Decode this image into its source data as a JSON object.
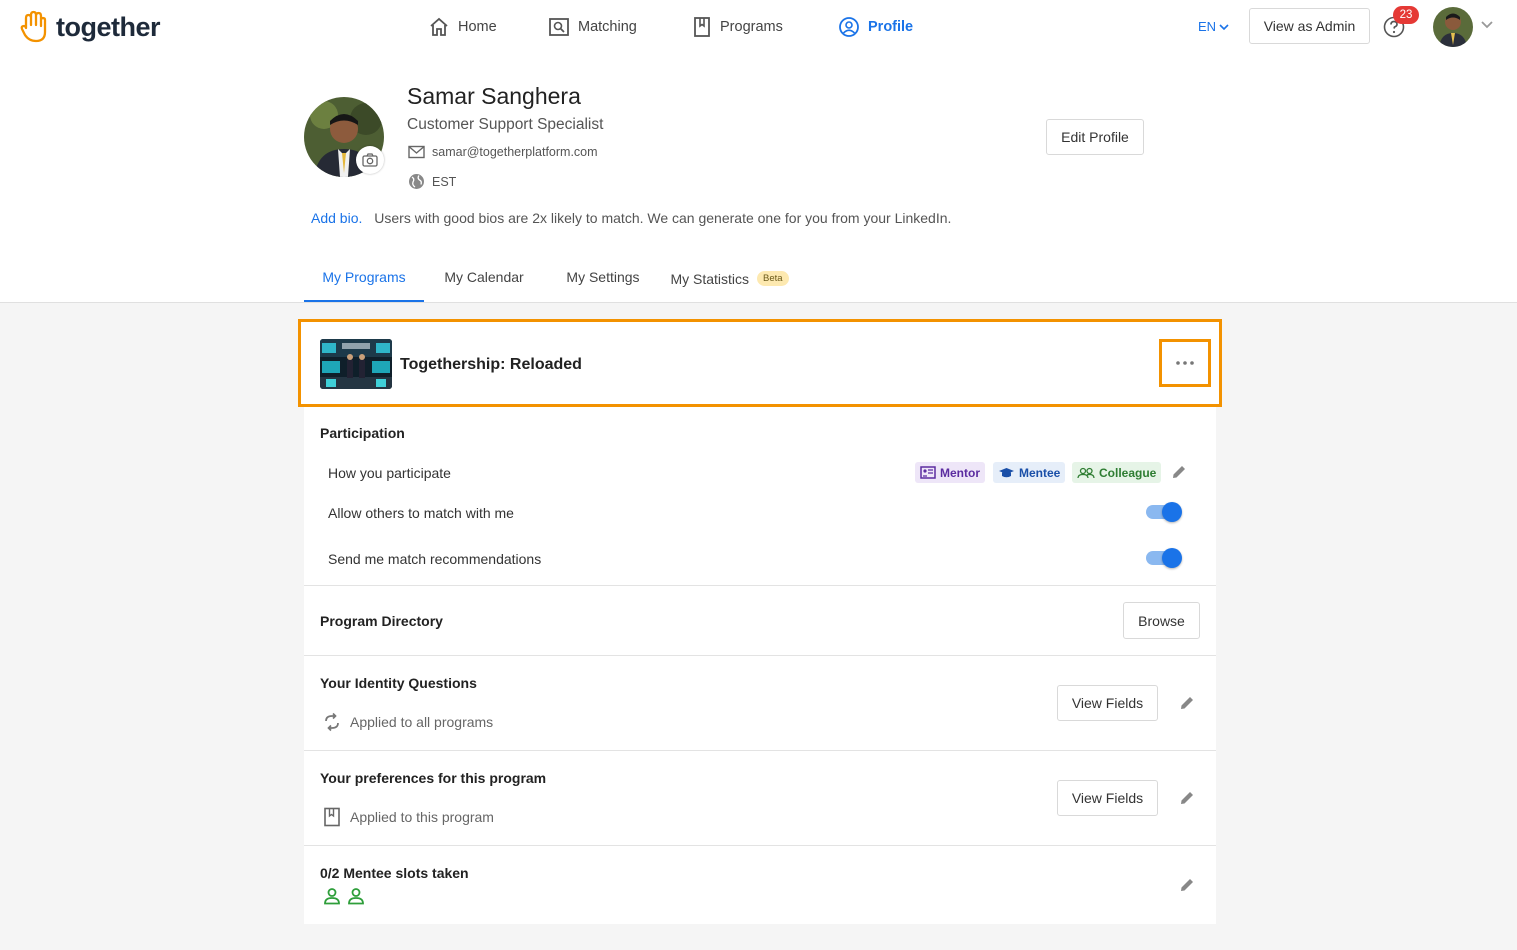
{
  "header": {
    "logo_text": "together",
    "nav": [
      {
        "label": "Home",
        "icon": "home-icon"
      },
      {
        "label": "Matching",
        "icon": "matching-icon"
      },
      {
        "label": "Programs",
        "icon": "programs-icon"
      },
      {
        "label": "Profile",
        "icon": "profile-icon"
      }
    ],
    "language": "EN",
    "admin_button": "View as Admin",
    "notifications_count": "23"
  },
  "profile": {
    "name": "Samar Sanghera",
    "title": "Customer Support Specialist",
    "email": "samar@togetherplatform.com",
    "timezone": "EST",
    "edit_button": "Edit Profile",
    "add_bio_link": "Add bio.",
    "bio_hint": "Users with good bios are 2x likely to match. We can generate one for you from your LinkedIn."
  },
  "tabs": [
    {
      "label": "My Programs",
      "active": true
    },
    {
      "label": "My Calendar",
      "active": false
    },
    {
      "label": "My Settings",
      "active": false
    },
    {
      "label": "My Statistics",
      "active": false,
      "badge": "Beta"
    }
  ],
  "program": {
    "title": "Togethership: Reloaded",
    "participation": {
      "heading": "Participation",
      "how_label": "How you participate",
      "roles": [
        {
          "label": "Mentor",
          "color": "#5b2ca0",
          "bg": "#eee6f8"
        },
        {
          "label": "Mentee",
          "color": "#1a4fa8",
          "bg": "#e6eef9"
        },
        {
          "label": "Colleague",
          "color": "#2e7d32",
          "bg": "#e6f4e7"
        }
      ],
      "allow_label": "Allow others to match with me",
      "allow_on": true,
      "recommend_label": "Send me match recommendations",
      "recommend_on": true
    },
    "directory": {
      "heading": "Program Directory",
      "button": "Browse"
    },
    "identity": {
      "heading": "Your Identity Questions",
      "sub": "Applied to all programs",
      "button": "View Fields"
    },
    "preferences": {
      "heading": "Your preferences for this program",
      "sub": "Applied to this program",
      "button": "View Fields"
    },
    "slots": {
      "heading": "0/2 Mentee slots taken",
      "slot_icon_color": "#2e9e3a"
    }
  },
  "colors": {
    "accent": "#1a73e8",
    "highlight": "#f39200"
  }
}
